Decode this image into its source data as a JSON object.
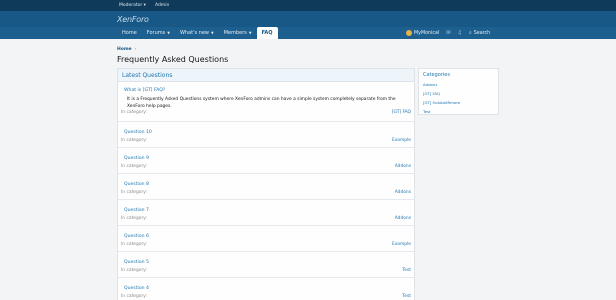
{
  "topbar": {
    "moderator": "Moderator",
    "admin": "Admin"
  },
  "header": {
    "logo": "XenForo"
  },
  "nav": {
    "home": "Home",
    "forums": "Forums",
    "whats_new": "What's new",
    "members": "Members",
    "faq": "FAQ",
    "user": "MyMonical",
    "search": "Search"
  },
  "breadcrumb": {
    "home": "Home"
  },
  "page": {
    "title": "Frequently Asked Questions"
  },
  "main": {
    "section_title": "Latest Questions",
    "category_label": "In category:",
    "questions": [
      {
        "title": "What is [GT] FAQ?",
        "body": "It is a Frequently Asked Questions system where XenForo admins can have a simple system completely separate from the XenForo help pages.",
        "category": "[GT] FAQ"
      },
      {
        "title": "Question 10",
        "category": "Example"
      },
      {
        "title": "Question 9",
        "category": "Addons"
      },
      {
        "title": "Question 8",
        "category": "Addons"
      },
      {
        "title": "Question 7",
        "category": "Addons"
      },
      {
        "title": "Question 6",
        "category": "Example"
      },
      {
        "title": "Question 5",
        "category": "Test"
      },
      {
        "title": "Question 4",
        "category": "Test"
      }
    ]
  },
  "sidebar": {
    "title": "Categories",
    "items": [
      "Addons",
      "[GT] FAQ",
      "[GT] SubAddRmore",
      "Test"
    ]
  }
}
